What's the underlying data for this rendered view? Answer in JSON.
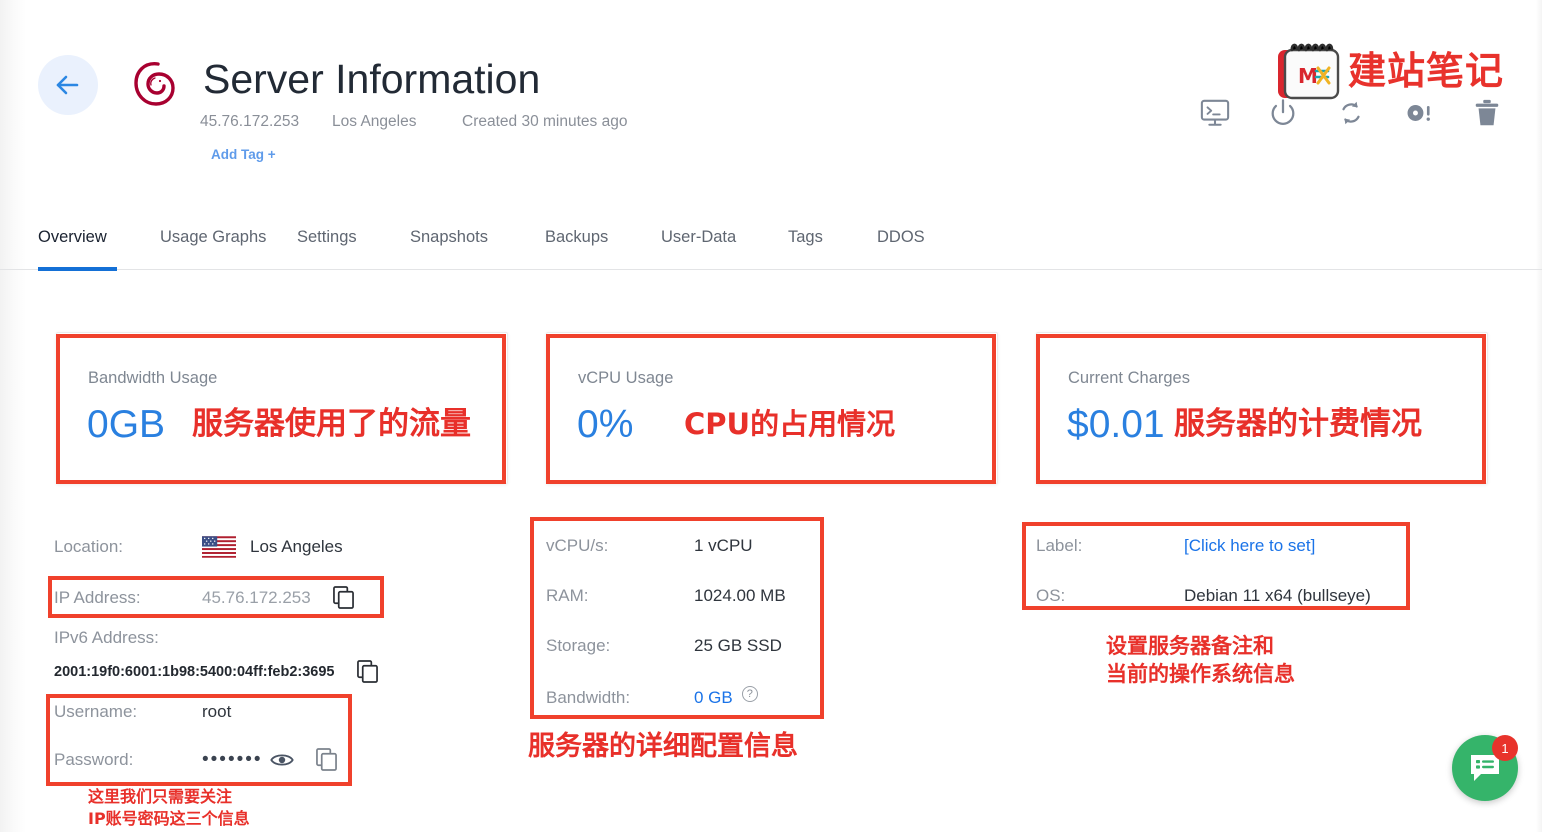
{
  "header": {
    "back_icon": "arrow-left-icon",
    "os_logo": "debian-swirl-logo",
    "title": "Server Information",
    "ip": "45.76.172.253",
    "location": "Los Angeles",
    "created": "Created 30 minutes ago",
    "add_tag": "Add Tag +"
  },
  "watermark": {
    "logo_text": "M≡X",
    "brand": "建站笔记"
  },
  "actions": [
    {
      "name": "console-icon",
      "title": "Console"
    },
    {
      "name": "power-icon",
      "title": "Power"
    },
    {
      "name": "restart-icon",
      "title": "Restart"
    },
    {
      "name": "reinstall-icon",
      "title": "Reinstall"
    },
    {
      "name": "trash-icon",
      "title": "Destroy"
    }
  ],
  "tabs": [
    {
      "label": "Overview",
      "active": true
    },
    {
      "label": "Usage Graphs",
      "active": false
    },
    {
      "label": "Settings",
      "active": false
    },
    {
      "label": "Snapshots",
      "active": false
    },
    {
      "label": "Backups",
      "active": false
    },
    {
      "label": "User-Data",
      "active": false
    },
    {
      "label": "Tags",
      "active": false
    },
    {
      "label": "DDOS",
      "active": false
    }
  ],
  "stat_cards": [
    {
      "label": "Bandwidth Usage",
      "value": "0GB"
    },
    {
      "label": "vCPU Usage",
      "value": "0%"
    },
    {
      "label": "Current Charges",
      "value": "$0.01"
    }
  ],
  "left_details": {
    "location_label": "Location:",
    "location_value": "Los Angeles",
    "ip_label": "IP Address:",
    "ip_value": "45.76.172.253",
    "ipv6_label": "IPv6 Address:",
    "ipv6_value": "2001:19f0:6001:1b98:5400:04ff:feb2:3695",
    "username_label": "Username:",
    "username_value": "root",
    "password_label": "Password:",
    "password_value": "•••••••"
  },
  "specs": {
    "vcpu_label": "vCPU/s:",
    "vcpu_value": "1 vCPU",
    "ram_label": "RAM:",
    "ram_value": "1024.00 MB",
    "storage_label": "Storage:",
    "storage_value": "25 GB SSD",
    "bandwidth_label": "Bandwidth:",
    "bandwidth_value": "0 GB",
    "bandwidth_help": "?"
  },
  "right_details": {
    "label_label": "Label:",
    "label_value": "[Click here to set]",
    "os_label": "OS:",
    "os_value": "Debian 11 x64 (bullseye)"
  },
  "annotations": {
    "bandwidth": "服务器使用了的流量",
    "vcpu": "CPU的占用情况",
    "charges": "服务器的计费情况",
    "specs": "服务器的详细配置信息",
    "credentials": "这里我们只需要关注\nIP账号密码这三个信息",
    "os_info": "设置服务器备注和\n当前的操作系统信息"
  },
  "chat": {
    "icon": "chat-bubble-icon",
    "badge": "1"
  },
  "colors": {
    "accent_blue": "#1a73e8",
    "stat_blue": "#2a80e0",
    "annotation_red": "#f0412c",
    "debian_crimson": "#a80030",
    "chat_green": "#35b46a",
    "badge_red": "#e8332b"
  }
}
